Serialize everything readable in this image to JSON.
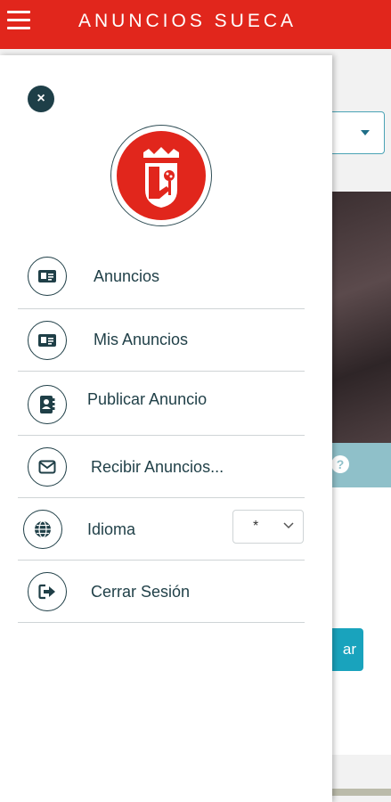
{
  "header": {
    "title": "ANUNCIOS SUECA",
    "menu_icon": "hamburger-icon"
  },
  "background": {
    "button_partial": "ar",
    "help_glyph": "?"
  },
  "drawer": {
    "close_glyph": "×",
    "logo_icon": "sueca-coat-of-arms",
    "menu": [
      {
        "label": "Anuncios",
        "icon": "id-card-icon"
      },
      {
        "label": "Mis Anuncios",
        "icon": "id-card-icon"
      },
      {
        "label": "Publicar Anuncio",
        "icon": "contact-book-icon"
      },
      {
        "label": "Recibir Anuncios...",
        "icon": "envelope-icon"
      },
      {
        "label": "Idioma",
        "icon": "globe-icon"
      },
      {
        "label": "Cerrar Sesión",
        "icon": "sign-out-icon"
      }
    ],
    "language": {
      "selected": "*"
    }
  },
  "colors": {
    "brand_red": "#e1261c",
    "dark_teal": "#1f3f47",
    "accent_teal": "#19a3bd"
  }
}
